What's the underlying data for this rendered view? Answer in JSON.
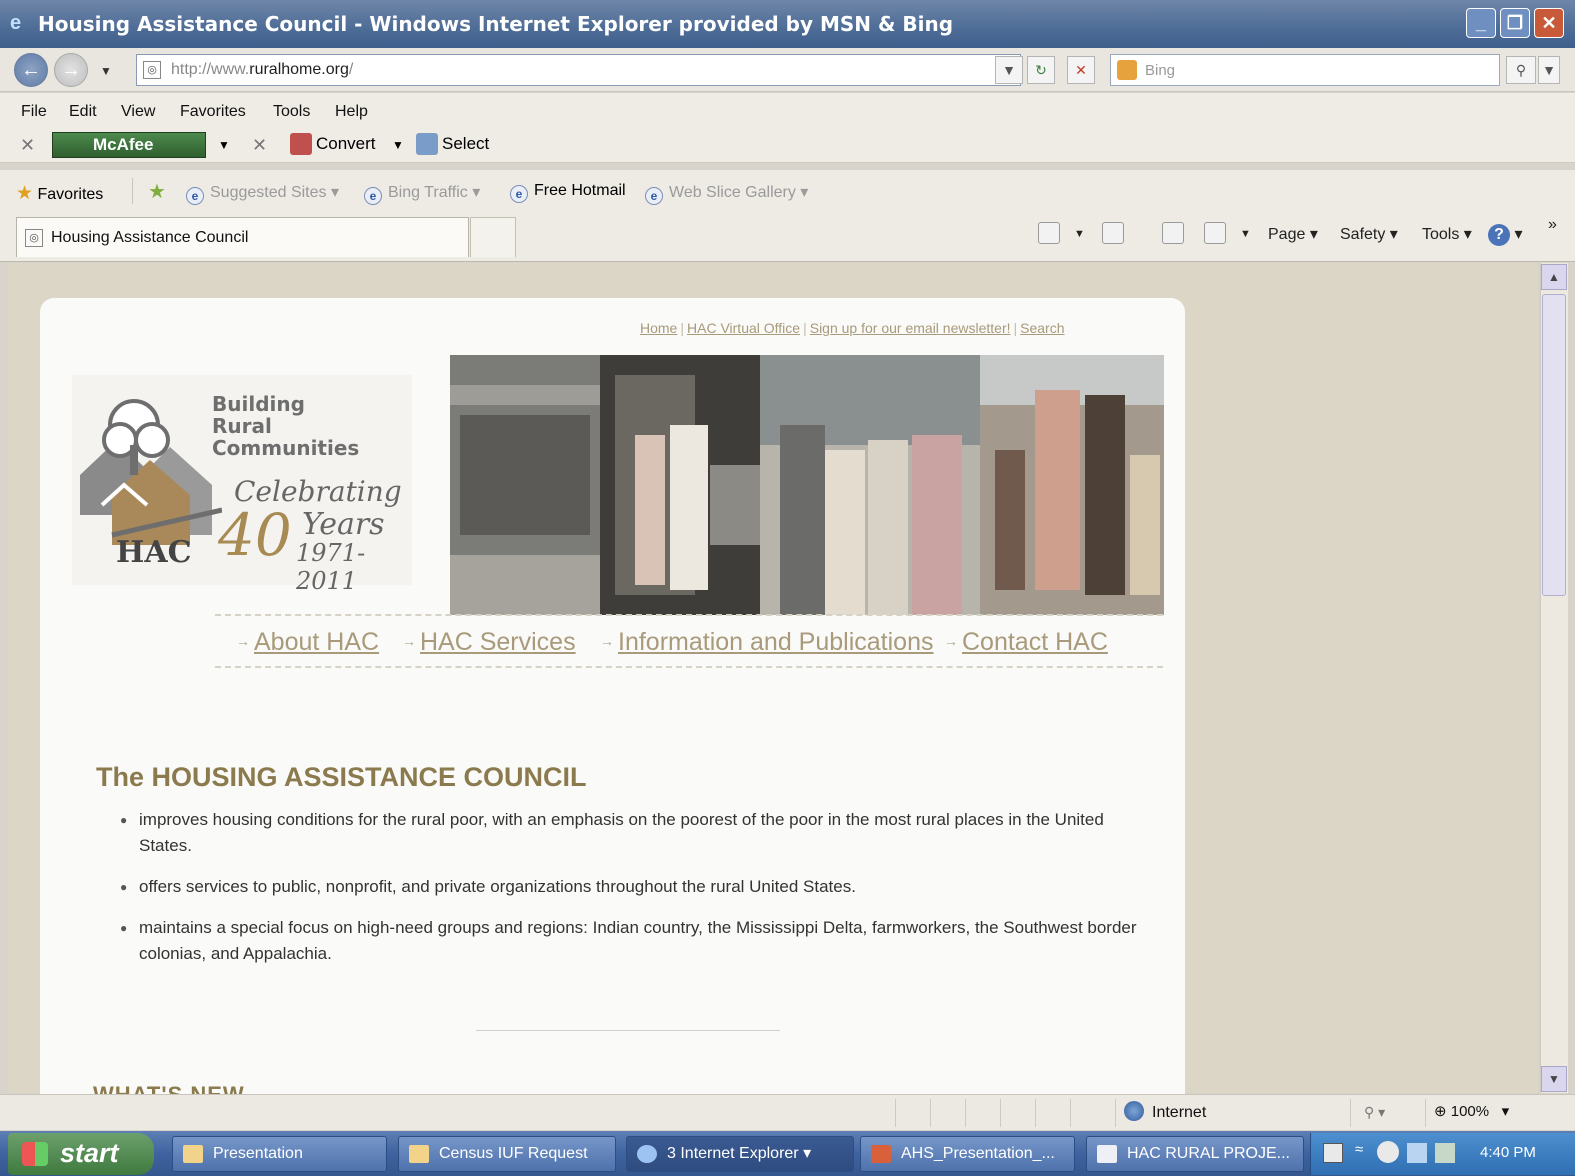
{
  "window": {
    "title": "Housing Assistance Council - Windows Internet Explorer provided by MSN & Bing",
    "controls": {
      "minimize": "_",
      "maximize": "❐",
      "close": "✕"
    }
  },
  "address_bar": {
    "url_prefix": "http://www.",
    "url_domain": "ruralhome.org",
    "url_suffix": "/",
    "search_placeholder": "Bing"
  },
  "menu": [
    "File",
    "Edit",
    "View",
    "Favorites",
    "Tools",
    "Help"
  ],
  "mcafee_bar": {
    "mcafee_label": "McAfee",
    "convert_label": "Convert",
    "select_label": "Select"
  },
  "favorites_bar": {
    "favorites_label": "Favorites",
    "items": [
      "Suggested Sites",
      "Bing Traffic",
      "Free Hotmail",
      "Web Slice Gallery"
    ]
  },
  "tab": {
    "title": "Housing Assistance Council"
  },
  "command_bar": {
    "page": "Page",
    "safety": "Safety",
    "tools": "Tools"
  },
  "site": {
    "top_links": [
      "Home",
      "HAC Virtual Office",
      "Sign up for our email newsletter!",
      "Search"
    ],
    "logo": {
      "tagline_1": "Building",
      "tagline_2": "Rural",
      "tagline_3": "Communities",
      "celebrating": "Celebrating",
      "number": "40",
      "years": "Years",
      "range": "1971-2011",
      "acronym": "HAC"
    },
    "main_nav": [
      "About HAC",
      "HAC Services",
      "Information and Publications",
      "Contact HAC"
    ],
    "heading": "The HOUSING ASSISTANCE COUNCIL",
    "bullets": [
      "improves housing conditions for the rural poor, with an emphasis on the poorest of the poor in the most rural places in the United States.",
      "offers services to public, nonprofit, and private organizations throughout the rural United States.",
      "maintains a special focus on high-need groups and regions: Indian country, the Mississippi Delta, farmworkers, the Southwest border colonias, and Appalachia."
    ],
    "whats_new": "WHAT'S NEW"
  },
  "status_bar": {
    "zone": "Internet",
    "zoom": "100%"
  },
  "taskbar": {
    "start": "start",
    "items": [
      "Presentation",
      "Census IUF Request",
      "3 Internet Explorer",
      "AHS_Presentation_...",
      "HAC RURAL PROJE..."
    ],
    "clock": "4:40 PM"
  }
}
